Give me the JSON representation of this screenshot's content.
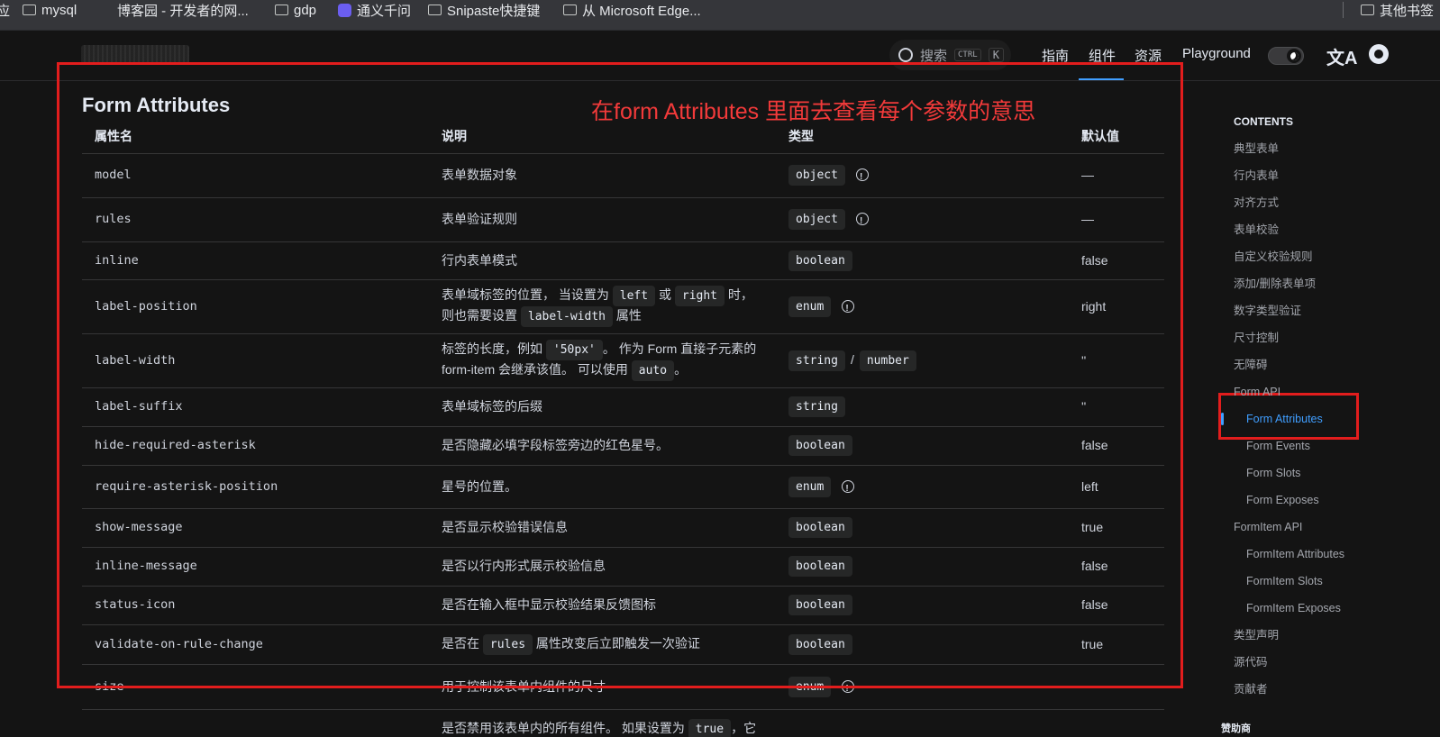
{
  "bookmarks": {
    "items": [
      {
        "label": "mysql",
        "icon": "folder-icon"
      },
      {
        "label": "博客园 - 开发者的网...",
        "icon": "none"
      },
      {
        "label": "gdp",
        "icon": "folder-icon"
      },
      {
        "label": "通义千问",
        "icon": "tongyi-logo-icon"
      },
      {
        "label": "Snipaste快捷键",
        "icon": "folder-icon"
      },
      {
        "label": "从 Microsoft Edge...",
        "icon": "folder-icon"
      }
    ],
    "left_partial": "应",
    "other_label": "其他书签"
  },
  "navbar": {
    "search_label": "搜索",
    "search_kbd_ctrl": "CTRL",
    "search_kbd_k": "K",
    "links": [
      {
        "label": "指南",
        "active": false
      },
      {
        "label": "组件",
        "active": true
      },
      {
        "label": "资源",
        "active": false
      },
      {
        "label": "Playground",
        "active": false
      }
    ],
    "translate_glyph": "文A",
    "accent_color": "#409eff"
  },
  "main": {
    "title": "Form Attributes",
    "annotation": "在form Attributes 里面去查看每个参数的意思",
    "columns": [
      "属性名",
      "说明",
      "类型",
      "默认值"
    ],
    "rows": [
      {
        "name": "model",
        "desc": "表单数据对象",
        "type": "object",
        "type_info": true,
        "default": "—"
      },
      {
        "name": "rules",
        "desc": "表单验证规则",
        "type": "object",
        "type_info": true,
        "default": "—"
      },
      {
        "name": "inline",
        "desc": "行内表单模式",
        "type": "boolean",
        "type_info": false,
        "default": "false"
      },
      {
        "name": "label-position",
        "desc_parts": [
          "表单域标签的位置， 当设置为 ",
          "left",
          " 或 ",
          "right",
          " 时，",
          "则也需要设置 ",
          "label-width",
          " 属性"
        ],
        "type": "enum",
        "type_info": true,
        "default": "right"
      },
      {
        "name": "label-width",
        "desc_parts": [
          "标签的长度，例如 ",
          "'50px'",
          "。 作为 Form 直接子元素的",
          "form-item 会继承该值。 可以使用 ",
          "auto",
          "。"
        ],
        "type": "string",
        "type2": "number",
        "default": "''"
      },
      {
        "name": "label-suffix",
        "desc": "表单域标签的后缀",
        "type": "string",
        "type_info": false,
        "default": "''"
      },
      {
        "name": "hide-required-asterisk",
        "desc": "是否隐藏必填字段标签旁边的红色星号。",
        "type": "boolean",
        "type_info": false,
        "default": "false"
      },
      {
        "name": "require-asterisk-position",
        "desc": "星号的位置。",
        "type": "enum",
        "type_info": true,
        "default": "left"
      },
      {
        "name": "show-message",
        "desc": "是否显示校验错误信息",
        "type": "boolean",
        "type_info": false,
        "default": "true"
      },
      {
        "name": "inline-message",
        "desc": "是否以行内形式展示校验信息",
        "type": "boolean",
        "type_info": false,
        "default": "false"
      },
      {
        "name": "status-icon",
        "desc": "是否在输入框中显示校验结果反馈图标",
        "type": "boolean",
        "type_info": false,
        "default": "false"
      },
      {
        "name": "validate-on-rule-change",
        "desc_parts": [
          "是否在 ",
          "rules",
          " 属性改变后立即触发一次验证"
        ],
        "type": "boolean",
        "type_info": false,
        "default": "true"
      },
      {
        "name": "size",
        "desc": "用于控制该表单内组件的尺寸",
        "type": "enum",
        "type_info": true,
        "default": "—"
      },
      {
        "name": "",
        "desc_parts": [
          "是否禁用该表单内的所有组件。 如果设置为 ",
          "true",
          "，它"
        ],
        "type": "",
        "default": ""
      }
    ]
  },
  "toc": {
    "title": "CONTENTS",
    "items": [
      {
        "label": "典型表单",
        "sub": false
      },
      {
        "label": "行内表单",
        "sub": false
      },
      {
        "label": "对齐方式",
        "sub": false
      },
      {
        "label": "表单校验",
        "sub": false
      },
      {
        "label": "自定义校验规则",
        "sub": false
      },
      {
        "label": "添加/删除表单项",
        "sub": false
      },
      {
        "label": "数字类型验证",
        "sub": false
      },
      {
        "label": "尺寸控制",
        "sub": false
      },
      {
        "label": "无障碍",
        "sub": false
      },
      {
        "label": "Form API",
        "sub": false
      },
      {
        "label": "Form Attributes",
        "sub": true,
        "active": true
      },
      {
        "label": "Form Events",
        "sub": true
      },
      {
        "label": "Form Slots",
        "sub": true
      },
      {
        "label": "Form Exposes",
        "sub": true
      },
      {
        "label": "FormItem API",
        "sub": false
      },
      {
        "label": "FormItem Attributes",
        "sub": true
      },
      {
        "label": "FormItem Slots",
        "sub": true
      },
      {
        "label": "FormItem Exposes",
        "sub": true
      },
      {
        "label": "类型声明",
        "sub": false
      },
      {
        "label": "源代码",
        "sub": false
      },
      {
        "label": "贡献者",
        "sub": false
      }
    ],
    "sponsor_label": "赞助商"
  },
  "colors": {
    "background": "#141414",
    "highlight_red": "#e21d1d",
    "annotation_red": "#f23a3a"
  }
}
